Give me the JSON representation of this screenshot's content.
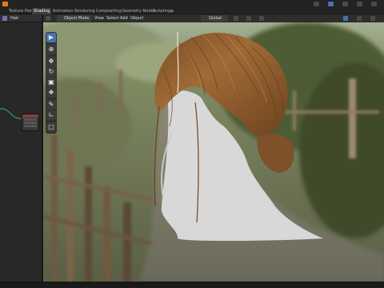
{
  "workspace_tabs": [
    {
      "label": "Texture Paint",
      "active": false
    },
    {
      "label": "Shading",
      "active": true
    },
    {
      "label": "Animation",
      "active": false
    },
    {
      "label": "Rendering",
      "active": false
    },
    {
      "label": "Compositing",
      "active": false
    },
    {
      "label": "Geometry Nodes",
      "active": false
    },
    {
      "label": "Scripting",
      "active": false
    }
  ],
  "add_workspace_symbol": "+",
  "left_panel": {
    "object_name": "Hair"
  },
  "viewport_header": {
    "mode": "Object Mode",
    "menus": [
      "View",
      "Select",
      "Add",
      "Object"
    ],
    "transform_orientation": "Global"
  },
  "toolbar_tools": [
    "select-box",
    "cursor",
    "move",
    "rotate",
    "scale",
    "transform",
    "annotate",
    "measure",
    "add-cube"
  ],
  "colors": {
    "accent": "#4772b3",
    "ui_background": "#232323",
    "hair": "#8a5a2e",
    "mannequin": "#d8d8d8",
    "foliage": "#4e5c34"
  }
}
